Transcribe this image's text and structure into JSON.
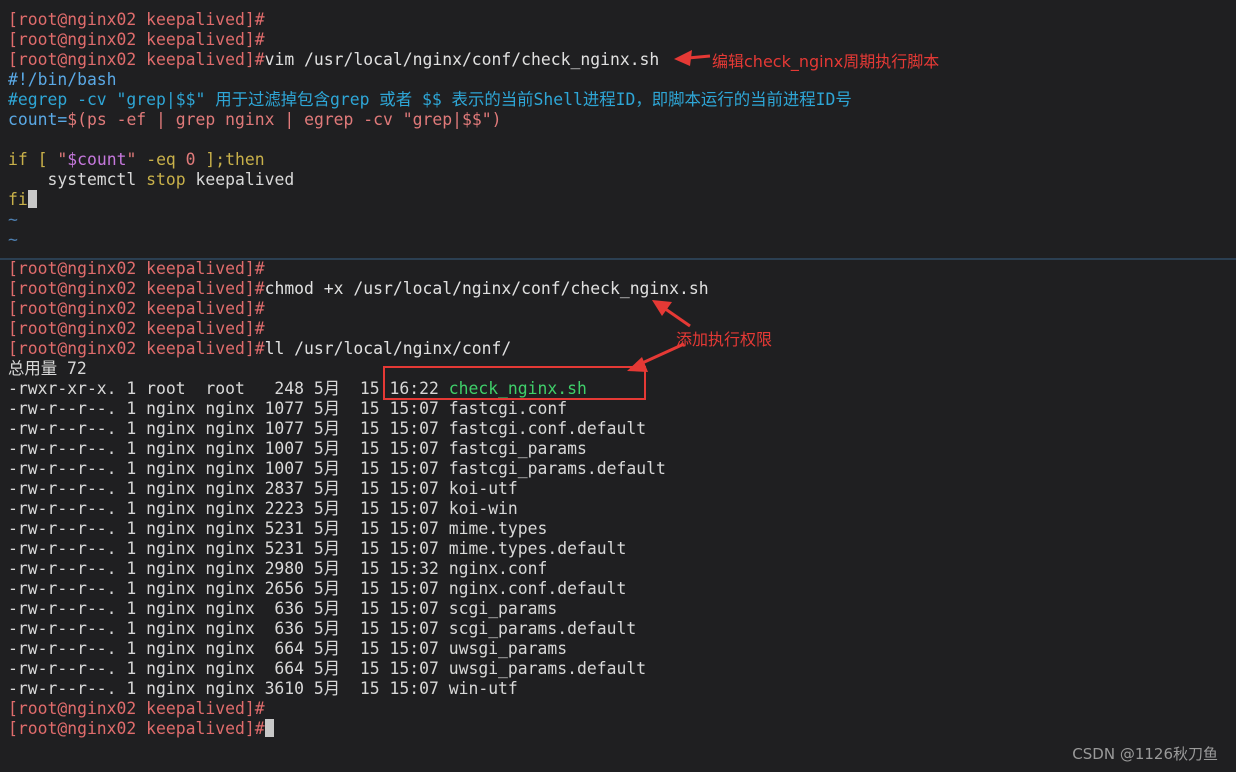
{
  "colors": {
    "background": "#1f1f21",
    "prompt": "#e06c6c",
    "annotation": "#e53935",
    "exec_file": "#3fcf6a",
    "comment": "#2ea6d6"
  },
  "top_pane": {
    "lines": [
      {
        "prompt": "[root@nginx02 keepalived]#",
        "cmd": ""
      },
      {
        "prompt": "[root@nginx02 keepalived]#",
        "cmd": ""
      },
      {
        "prompt": "[root@nginx02 keepalived]#",
        "cmd": "vim /usr/local/nginx/conf/check_nginx.sh"
      }
    ],
    "script": {
      "shebang": "#!/bin/bash",
      "comment": "#egrep -cv \"grep|$$\" 用于过滤掉包含grep 或者 $$ 表示的当前Shell进程ID，即脚本运行的当前进程ID号",
      "count_var": "count=",
      "count_sub_open": "$(",
      "count_ps": "ps -ef | ",
      "count_grep": "grep nginx | ",
      "count_egrep": "egrep -cv ",
      "count_str": "\"grep|$$\"",
      "count_close": ")",
      "if_kw": "if",
      "if_bracket": " [ ",
      "if_str_open": "\"",
      "if_var": "$count",
      "if_str_close": "\"",
      "if_op": " -eq ",
      "if_zero": "0",
      "if_end": " ];",
      "then_kw": "then",
      "body_indent": "    systemctl ",
      "body_stop": "stop",
      "body_rest": " keepalived",
      "fi": "fi",
      "tilde": "~"
    }
  },
  "bottom_pane": {
    "lines": [
      {
        "prompt": "[root@nginx02 keepalived]#",
        "cmd": ""
      },
      {
        "prompt": "[root@nginx02 keepalived]#",
        "cmd": "chmod +x /usr/local/nginx/conf/check_nginx.sh"
      },
      {
        "prompt": "[root@nginx02 keepalived]#",
        "cmd": ""
      },
      {
        "prompt": "[root@nginx02 keepalived]#",
        "cmd": ""
      },
      {
        "prompt": "[root@nginx02 keepalived]#",
        "cmd": "ll /usr/local/nginx/conf/"
      }
    ],
    "total": "总用量 72",
    "listing": [
      {
        "meta": "-rwxr-xr-x. 1 root  root   248 5月  15 16:22 ",
        "name": "check_nginx.sh",
        "exec": true
      },
      {
        "meta": "-rw-r--r--. 1 nginx nginx 1077 5月  15 15:07 ",
        "name": "fastcgi.conf",
        "exec": false
      },
      {
        "meta": "-rw-r--r--. 1 nginx nginx 1077 5月  15 15:07 ",
        "name": "fastcgi.conf.default",
        "exec": false
      },
      {
        "meta": "-rw-r--r--. 1 nginx nginx 1007 5月  15 15:07 ",
        "name": "fastcgi_params",
        "exec": false
      },
      {
        "meta": "-rw-r--r--. 1 nginx nginx 1007 5月  15 15:07 ",
        "name": "fastcgi_params.default",
        "exec": false
      },
      {
        "meta": "-rw-r--r--. 1 nginx nginx 2837 5月  15 15:07 ",
        "name": "koi-utf",
        "exec": false
      },
      {
        "meta": "-rw-r--r--. 1 nginx nginx 2223 5月  15 15:07 ",
        "name": "koi-win",
        "exec": false
      },
      {
        "meta": "-rw-r--r--. 1 nginx nginx 5231 5月  15 15:07 ",
        "name": "mime.types",
        "exec": false
      },
      {
        "meta": "-rw-r--r--. 1 nginx nginx 5231 5月  15 15:07 ",
        "name": "mime.types.default",
        "exec": false
      },
      {
        "meta": "-rw-r--r--. 1 nginx nginx 2980 5月  15 15:32 ",
        "name": "nginx.conf",
        "exec": false
      },
      {
        "meta": "-rw-r--r--. 1 nginx nginx 2656 5月  15 15:07 ",
        "name": "nginx.conf.default",
        "exec": false
      },
      {
        "meta": "-rw-r--r--. 1 nginx nginx  636 5月  15 15:07 ",
        "name": "scgi_params",
        "exec": false
      },
      {
        "meta": "-rw-r--r--. 1 nginx nginx  636 5月  15 15:07 ",
        "name": "scgi_params.default",
        "exec": false
      },
      {
        "meta": "-rw-r--r--. 1 nginx nginx  664 5月  15 15:07 ",
        "name": "uwsgi_params",
        "exec": false
      },
      {
        "meta": "-rw-r--r--. 1 nginx nginx  664 5月  15 15:07 ",
        "name": "uwsgi_params.default",
        "exec": false
      },
      {
        "meta": "-rw-r--r--. 1 nginx nginx 3610 5月  15 15:07 ",
        "name": "win-utf",
        "exec": false
      }
    ],
    "end_lines": [
      {
        "prompt": "[root@nginx02 keepalived]#"
      },
      {
        "prompt": "[root@nginx02 keepalived]#"
      }
    ]
  },
  "annotations": {
    "edit_note": "编辑check_nginx周期执行脚本",
    "perm_note": "添加执行权限"
  },
  "watermark": "CSDN @1126秋刀鱼"
}
